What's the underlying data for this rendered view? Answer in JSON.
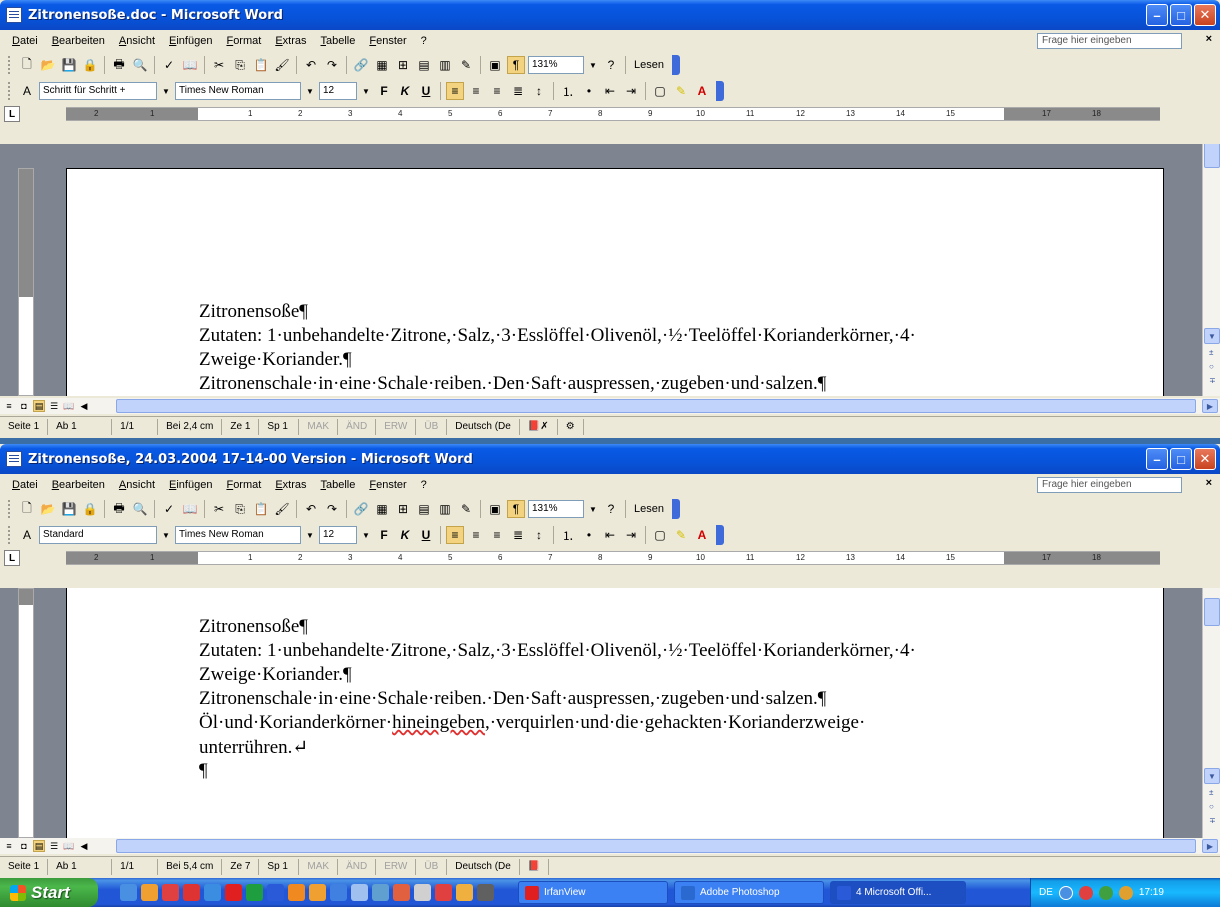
{
  "colors": {
    "titlebar": "#0753d9",
    "desktop": "#3a6ea5",
    "toolbar": "#ece9d8",
    "active_button": "#f3d37f",
    "spell_error": "#e03030"
  },
  "menu": {
    "items": [
      "Datei",
      "Bearbeiten",
      "Ansicht",
      "Einfügen",
      "Format",
      "Extras",
      "Tabelle",
      "Fenster",
      "?"
    ],
    "ask_placeholder": "Frage hier eingeben",
    "close": "×"
  },
  "toolbar": {
    "zoom": "131%",
    "lesen": "Lesen",
    "bold": "F",
    "italic": "K",
    "underline": "U"
  },
  "ruler": {
    "tab_marker": "L",
    "ticks": [
      "2",
      "1",
      "1",
      "2",
      "3",
      "4",
      "5",
      "6",
      "7",
      "8",
      "9",
      "10",
      "11",
      "12",
      "13",
      "14",
      "15",
      "17",
      "18"
    ]
  },
  "window1": {
    "title": "Zitronensoße.doc - Microsoft Word",
    "style": "Schritt für Schritt +",
    "font": "Times New Roman",
    "size": "12",
    "lines": [
      "Zitronensoße¶",
      "Zutaten: 1·unbehandelte·Zitrone,·Salz,·3·Esslöffel·Olivenöl,·½·Teelöffel·Korianderkörner,·4·",
      "Zweige·Koriander.¶",
      "Zitronenschale·in·eine·Schale·reiben.·Den·Saft·auspressen,·zugeben·und·salzen.¶"
    ],
    "status": {
      "page": "Seite 1",
      "section": "Ab 1",
      "pages": "1/1",
      "pos": "Bei 2,4 cm",
      "line": "Ze 1",
      "col": "Sp 1",
      "mak": "MAK",
      "aend": "ÄND",
      "erw": "ERW",
      "ueb": "ÜB",
      "lang": "Deutsch (De"
    }
  },
  "window2": {
    "title": "Zitronensoße, 24.03.2004 17-14-00 Version - Microsoft Word",
    "style": "Standard",
    "font": "Times New Roman",
    "size": "12",
    "lines": [
      "Zitronensoße¶",
      "Zutaten: 1·unbehandelte·Zitrone,·Salz,·3·Esslöffel·Olivenöl,·½·Teelöffel·Korianderkörner,·4·",
      "Zweige·Koriander.¶",
      "Zitronenschale·in·eine·Schale·reiben.·Den·Saft·auspressen,·zugeben·und·salzen.¶"
    ],
    "line5_pre": "Öl·und·Korianderkörner·",
    "line5_err": "hineingeben",
    "line5_post": ",·verquirlen·und·die·gehackten·Korianderzweige·",
    "line6": "unterrühren.↵",
    "line7": "¶",
    "status": {
      "page": "Seite 1",
      "section": "Ab 1",
      "pages": "1/1",
      "pos": "Bei 5,4 cm",
      "line": "Ze 7",
      "col": "Sp 1",
      "mak": "MAK",
      "aend": "ÄND",
      "erw": "ERW",
      "ueb": "ÜB",
      "lang": "Deutsch (De"
    }
  },
  "taskbar": {
    "start": "Start",
    "tasks": [
      "IrfanView",
      "Adobe Photoshop",
      "4 Microsoft Offi..."
    ],
    "lang": "DE",
    "clock": "17:19"
  }
}
